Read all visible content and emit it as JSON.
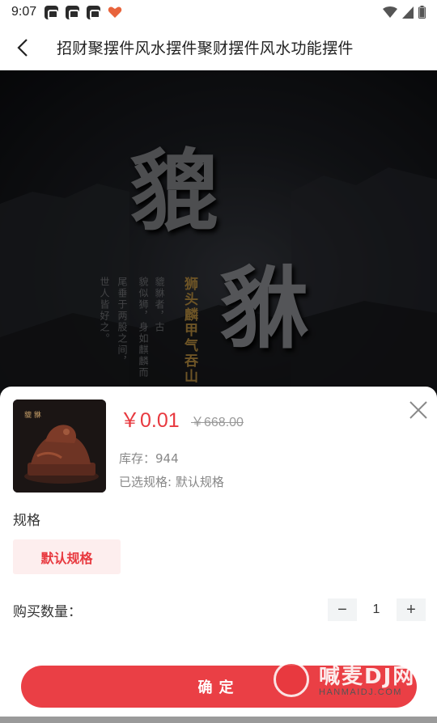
{
  "status_bar": {
    "time": "9:07"
  },
  "header": {
    "title": "招财聚摆件风水摆件聚财摆件风水功能摆件"
  },
  "hero": {
    "big_char_1": "貔",
    "big_char_2": "貅",
    "gold_text": "狮头麟甲气吞山",
    "small_lines": [
      "貔貅者，古",
      "貌似狮，身如麒麟而",
      "尾垂于两股之间，",
      "世人皆好之。"
    ]
  },
  "sheet": {
    "price_current": "￥0.01",
    "price_original": "￥668.00",
    "stock": "库存：944",
    "selected_spec": "已选规格: 默认规格",
    "spec_title": "规格",
    "spec_option": "默认规格",
    "qty_label": "购买数量：",
    "qty_minus": "−",
    "qty_value": "1",
    "qty_plus": "+",
    "confirm": "确定"
  },
  "watermark": {
    "text": "喊麦DJ网",
    "sub": "HANMAIDJ.COM"
  },
  "colors": {
    "accent": "#e8393f",
    "spec_bg": "#fdeeee"
  }
}
